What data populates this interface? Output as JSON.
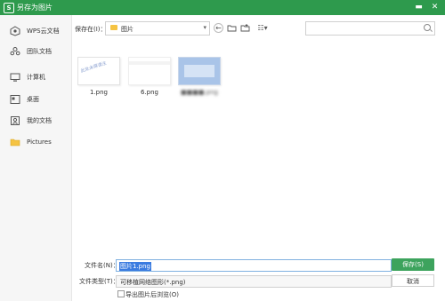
{
  "window": {
    "title": "另存为图片",
    "minimize_glyph": "▬",
    "close_glyph": "✕",
    "app_glyph": "S"
  },
  "sidebar": {
    "items": [
      {
        "label": "WPS云文档",
        "icon": "cloud-doc-icon"
      },
      {
        "label": "团队文档",
        "icon": "team-doc-icon"
      },
      {
        "label": "计算机",
        "icon": "computer-icon"
      },
      {
        "label": "桌面",
        "icon": "desktop-icon"
      },
      {
        "label": "我的文档",
        "icon": "my-documents-icon"
      },
      {
        "label": "Pictures",
        "icon": "folder-icon"
      }
    ]
  },
  "toolbar": {
    "save_in_label": "保存在(I)：",
    "path_value": "图片",
    "back_glyph": "←",
    "up_glyph": "⬆",
    "new_folder_glyph": "✚",
    "view_glyph": "☷▾"
  },
  "files": [
    {
      "name": "1.png",
      "thumb_text": "此处未得请注"
    },
    {
      "name": "6.png",
      "thumb_text": ""
    },
    {
      "name": "■■■■.png",
      "thumb_text": ""
    }
  ],
  "bottom": {
    "filename_label": "文件名(N)：",
    "filename_value": "图片1.png",
    "filetype_label": "文件类型(T)：",
    "filetype_value": "可移植网络图形(*.png)",
    "save_label": "保存(S)",
    "cancel_label": "取消",
    "export_checkbox_label": "导出图片后浏览(O)"
  },
  "colors": {
    "accent": "#2e9a4d",
    "selection": "#3a7be0",
    "folder": "#f5c342"
  }
}
